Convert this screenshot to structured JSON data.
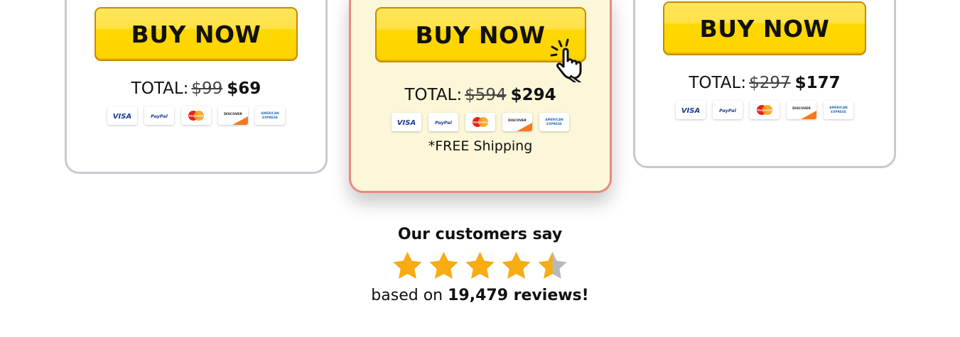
{
  "offers": [
    {
      "buy_label": "BUY NOW",
      "total_label": "TOTAL:",
      "old_price": "$99",
      "new_price": "$69",
      "shipping": ""
    },
    {
      "buy_label": "BUY NOW",
      "total_label": "TOTAL:",
      "old_price": "$594",
      "new_price": "$294",
      "shipping": "*FREE Shipping"
    },
    {
      "buy_label": "BUY NOW",
      "total_label": "TOTAL:",
      "old_price": "$297",
      "new_price": "$177",
      "shipping": ""
    }
  ],
  "payment_methods": [
    {
      "name": "visa",
      "label": "VISA",
      "icon": "visa-icon"
    },
    {
      "name": "paypal",
      "label": "PayPal",
      "icon": "paypal-icon"
    },
    {
      "name": "mastercard",
      "label": "MasterCard",
      "icon": "mastercard-icon"
    },
    {
      "name": "discover",
      "label": "DISCOVER",
      "icon": "discover-icon"
    },
    {
      "name": "amex",
      "label": "AMERICAN EXPRESS",
      "icon": "amex-icon"
    }
  ],
  "reviews": {
    "title": "Our customers say",
    "rating": 4.5,
    "rating_max": 5,
    "based_prefix": "based on",
    "count": "19,479 reviews!"
  },
  "colors": {
    "button_yellow": "#ffd800",
    "highlight_card_bg": "#fbf7d8",
    "highlight_card_border": "#e98a80",
    "star_fill": "#f7ac12",
    "star_empty": "#b9b9b9"
  }
}
